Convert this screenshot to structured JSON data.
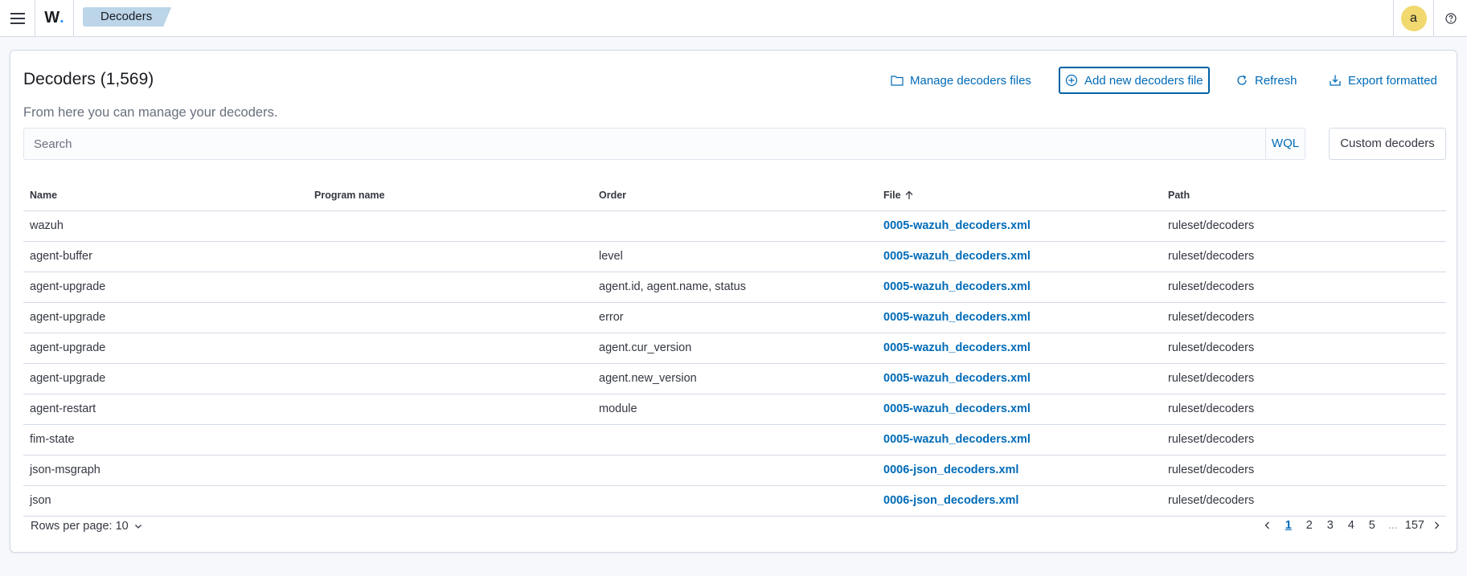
{
  "header": {
    "logo_text": "W",
    "logo_dot": ".",
    "breadcrumb": "Decoders",
    "avatar_letter": "a"
  },
  "page": {
    "title": "Decoders (1,569)",
    "subtitle": "From here you can manage your decoders."
  },
  "actions": {
    "manage_files": "Manage decoders files",
    "add_file": "Add new decoders file",
    "refresh": "Refresh",
    "export": "Export formatted"
  },
  "search": {
    "placeholder": "Search",
    "wql_label": "WQL",
    "custom_button": "Custom decoders"
  },
  "table": {
    "columns": [
      "Name",
      "Program name",
      "Order",
      "File",
      "Path"
    ],
    "rows": [
      {
        "name": "wazuh",
        "program": "",
        "order": "",
        "file": "0005-wazuh_decoders.xml",
        "path": "ruleset/decoders"
      },
      {
        "name": "agent-buffer",
        "program": "",
        "order": "level",
        "file": "0005-wazuh_decoders.xml",
        "path": "ruleset/decoders"
      },
      {
        "name": "agent-upgrade",
        "program": "",
        "order": "agent.id, agent.name, status",
        "file": "0005-wazuh_decoders.xml",
        "path": "ruleset/decoders"
      },
      {
        "name": "agent-upgrade",
        "program": "",
        "order": "error",
        "file": "0005-wazuh_decoders.xml",
        "path": "ruleset/decoders"
      },
      {
        "name": "agent-upgrade",
        "program": "",
        "order": "agent.cur_version",
        "file": "0005-wazuh_decoders.xml",
        "path": "ruleset/decoders"
      },
      {
        "name": "agent-upgrade",
        "program": "",
        "order": "agent.new_version",
        "file": "0005-wazuh_decoders.xml",
        "path": "ruleset/decoders"
      },
      {
        "name": "agent-restart",
        "program": "",
        "order": "module",
        "file": "0005-wazuh_decoders.xml",
        "path": "ruleset/decoders"
      },
      {
        "name": "fim-state",
        "program": "",
        "order": "",
        "file": "0005-wazuh_decoders.xml",
        "path": "ruleset/decoders"
      },
      {
        "name": "json-msgraph",
        "program": "",
        "order": "",
        "file": "0006-json_decoders.xml",
        "path": "ruleset/decoders"
      },
      {
        "name": "json",
        "program": "",
        "order": "",
        "file": "0006-json_decoders.xml",
        "path": "ruleset/decoders"
      }
    ]
  },
  "footer": {
    "rows_per_page": "Rows per page: 10",
    "pages": [
      "1",
      "2",
      "3",
      "4",
      "5",
      "...",
      "157"
    ],
    "active_page": "1"
  },
  "colors": {
    "link": "#006bb8",
    "breadcrumb_bg": "#bcd5e8",
    "avatar_bg": "#f1d86f",
    "border": "#d3dae6"
  },
  "icons": [
    "menu-icon",
    "folder-icon",
    "plus-circle-icon",
    "refresh-icon",
    "export-icon",
    "sort-up-icon",
    "chevron-down-icon",
    "chevron-left-icon",
    "chevron-right-icon",
    "help-icon"
  ]
}
